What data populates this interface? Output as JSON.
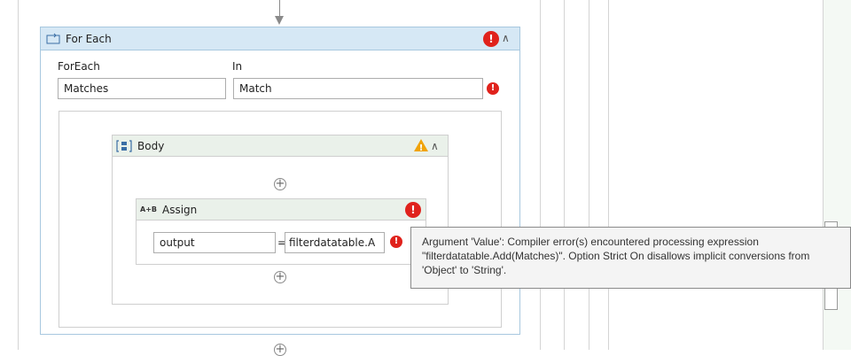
{
  "foreach": {
    "title": "For Each",
    "foreach_label": "ForEach",
    "foreach_value": "Matches",
    "in_label": "In",
    "in_value": "Match"
  },
  "body": {
    "title": "Body"
  },
  "assign": {
    "title": "Assign",
    "type_badge": "A+B",
    "to_value": "output",
    "equals": "=",
    "value_value": "filterdatatable.A"
  },
  "error_glyph": "!",
  "warning_glyph": "!",
  "collapse_glyph": "∧",
  "add_glyph": "+",
  "tooltip": {
    "text": "Argument 'Value': Compiler error(s) encountered processing expression \"filterdatatable.Add(Matches)\". Option Strict On disallows implicit conversions from 'Object' to 'String'."
  },
  "colors": {
    "error": "#e0221c",
    "warning": "#f0a30a",
    "foreach_header": "#d6e8f5",
    "activity_header": "#eaf1ea"
  }
}
